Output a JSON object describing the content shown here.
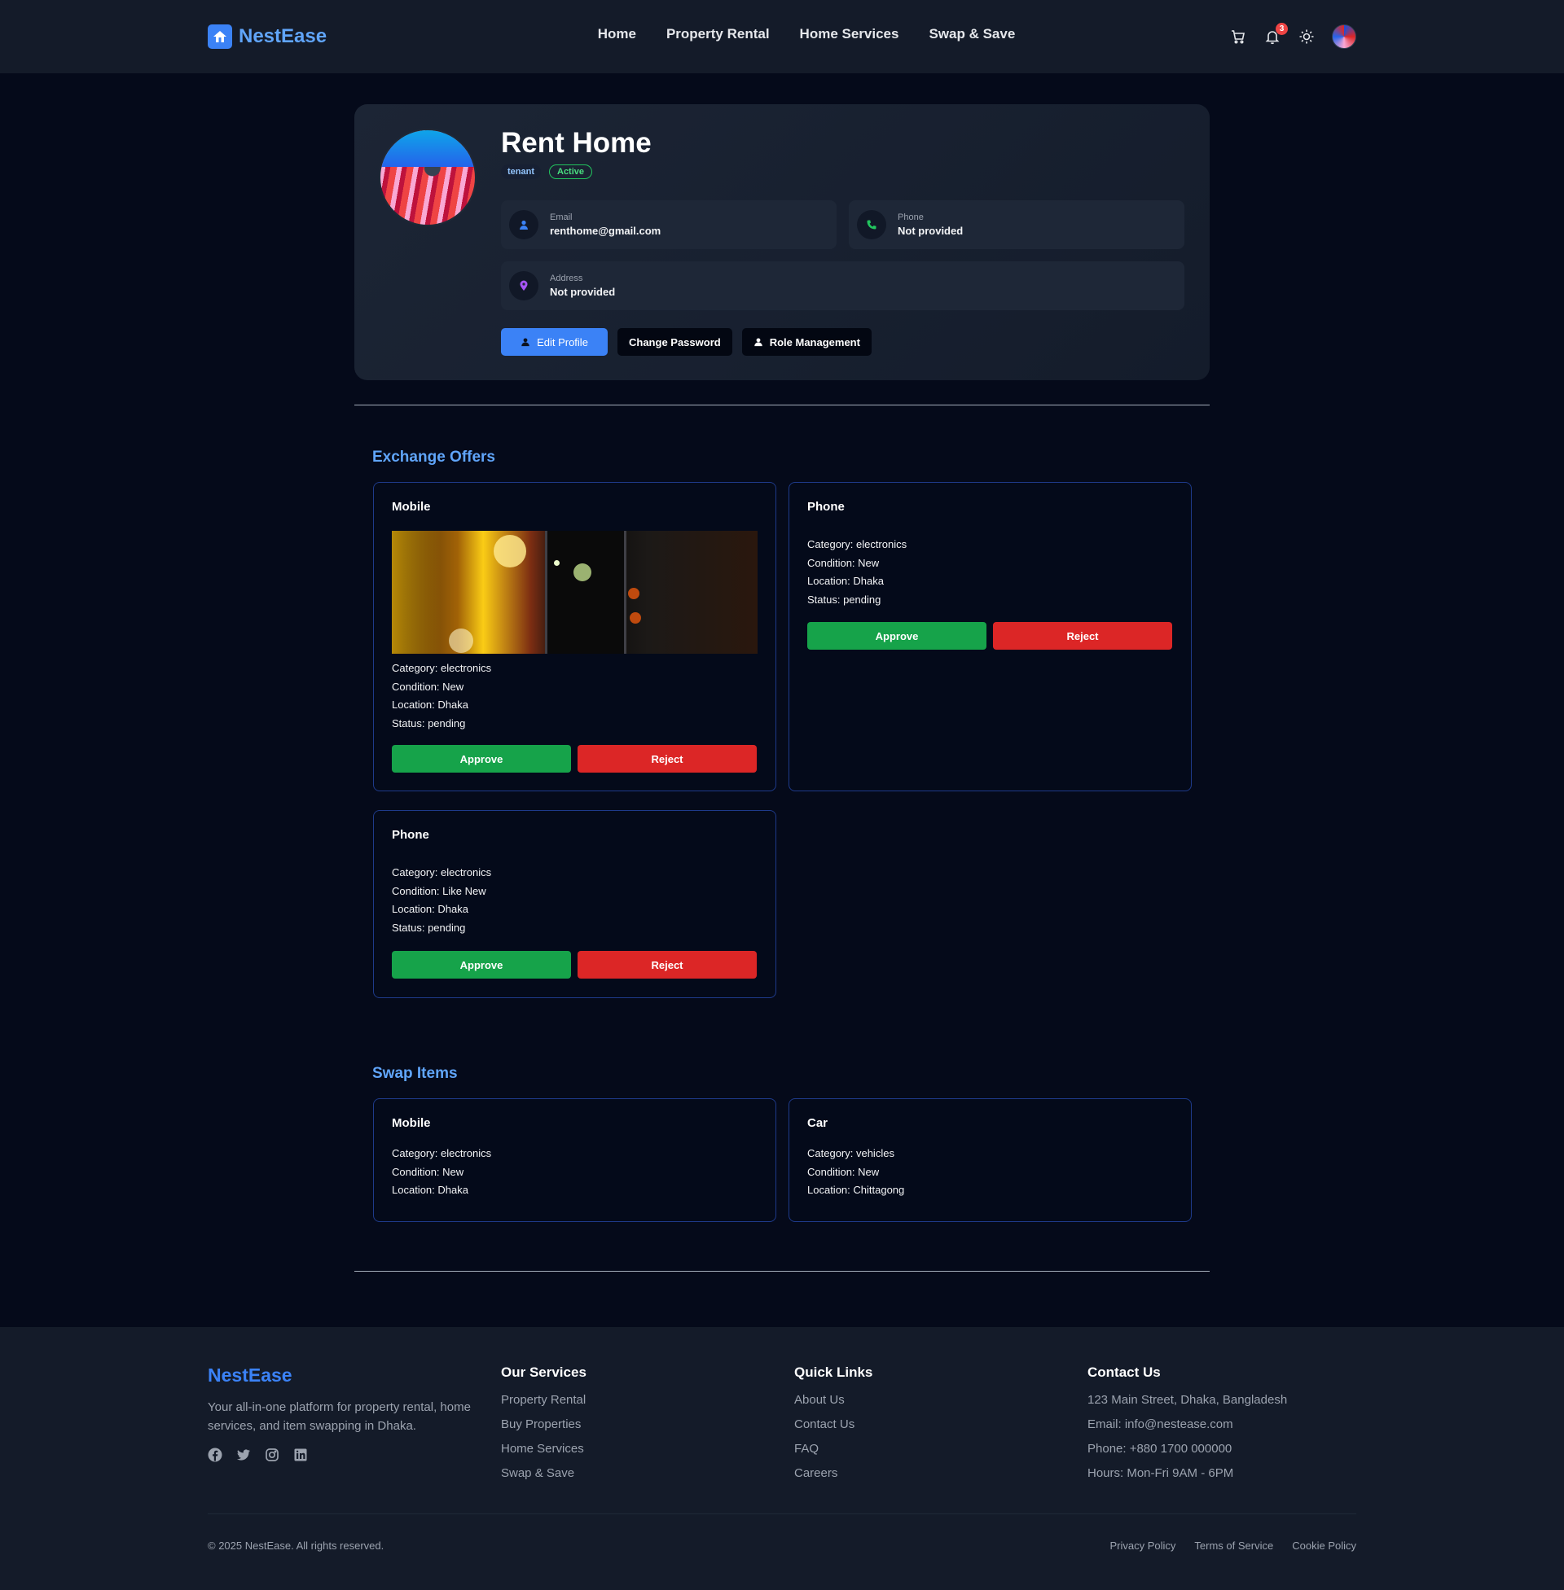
{
  "header": {
    "brand": "NestEase",
    "nav": [
      "Home",
      "Property Rental",
      "Home Services",
      "Swap & Save"
    ],
    "notification_count": "3",
    "icons": [
      "home-logo-icon",
      "cart-icon",
      "bell-icon",
      "sun-icon",
      "user-avatar"
    ]
  },
  "profile": {
    "name": "Rent Home",
    "role": "tenant",
    "status": "Active",
    "email_label": "Email",
    "email": "renthome@gmail.com",
    "phone_label": "Phone",
    "phone": "Not provided",
    "address_label": "Address",
    "address": "Not provided",
    "actions": {
      "edit": "Edit Profile",
      "password": "Change Password",
      "roles": "Role Management"
    }
  },
  "exchange_offers": {
    "title": "Exchange Offers",
    "approve_label": "Approve",
    "reject_label": "Reject",
    "items": [
      {
        "name": "Mobile",
        "category": "Category: electronics",
        "condition": "Condition: New",
        "location": "Location: Dhaka",
        "status": "Status: pending"
      },
      {
        "name": "Phone",
        "category": "Category: electronics",
        "condition": "Condition: New",
        "location": "Location: Dhaka",
        "status": "Status: pending"
      },
      {
        "name": "Phone",
        "category": "Category: electronics",
        "condition": "Condition: Like New",
        "location": "Location: Dhaka",
        "status": "Status: pending"
      }
    ]
  },
  "swap_items": {
    "title": "Swap Items",
    "items": [
      {
        "name": "Mobile",
        "category": "Category: electronics",
        "condition": "Condition: New",
        "location": "Location: Dhaka"
      },
      {
        "name": "Car",
        "category": "Category: vehicles",
        "condition": "Condition: New",
        "location": "Location: Chittagong"
      }
    ]
  },
  "footer": {
    "brand": "NestEase",
    "description": "Your all-in-one platform for property rental, home services, and item swapping in Dhaka.",
    "social": [
      "facebook-icon",
      "twitter-icon",
      "instagram-icon",
      "linkedin-icon"
    ],
    "services_title": "Our Services",
    "services": [
      "Property Rental",
      "Buy Properties",
      "Home Services",
      "Swap & Save"
    ],
    "links_title": "Quick Links",
    "links": [
      "About Us",
      "Contact Us",
      "FAQ",
      "Careers"
    ],
    "contact_title": "Contact Us",
    "contact": [
      "123 Main Street, Dhaka, Bangladesh",
      "Email: info@nestease.com",
      "Phone: +880 1700 000000",
      "Hours: Mon-Fri 9AM - 6PM"
    ],
    "copyright": "© 2025 NestEase. All rights reserved.",
    "legal": [
      "Privacy Policy",
      "Terms of Service",
      "Cookie Policy"
    ]
  },
  "colors": {
    "accent": "#3b82f6",
    "approve": "#16a34a",
    "reject": "#dc2626",
    "page_bg": "#050a1a",
    "header_bg": "#141b29"
  }
}
